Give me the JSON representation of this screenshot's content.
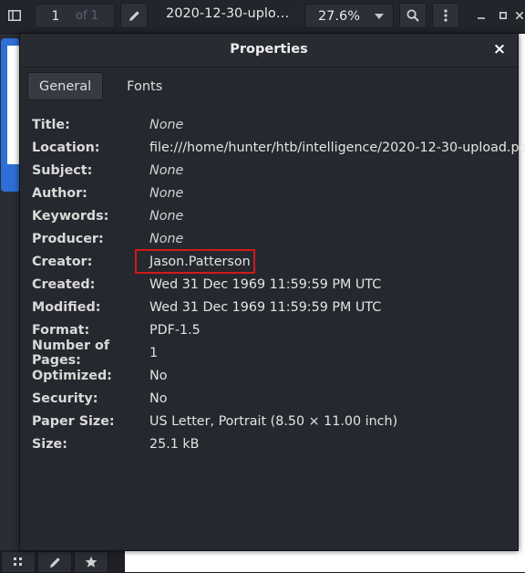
{
  "toolbar": {
    "page_number": "1",
    "page_total": "of 1",
    "document_title": "2020-12-30-uploa...",
    "zoom_level": "27.6%"
  },
  "dialog": {
    "title": "Properties",
    "close_label": "×",
    "tabs": [
      {
        "label": "General",
        "active": true
      },
      {
        "label": "Fonts",
        "active": false
      }
    ],
    "properties": [
      {
        "label": "Title:",
        "value": "None"
      },
      {
        "label": "Location:",
        "value": "file:///home/hunter/htb/intelligence/2020-12-30-upload.pdf"
      },
      {
        "label": "Subject:",
        "value": "None"
      },
      {
        "label": "Author:",
        "value": "None"
      },
      {
        "label": "Keywords:",
        "value": "None"
      },
      {
        "label": "Producer:",
        "value": "None"
      },
      {
        "label": "Creator:",
        "value": "Jason.Patterson"
      },
      {
        "label": "Created:",
        "value": "Wed 31 Dec 1969 11:59:59 PM UTC"
      },
      {
        "label": "Modified:",
        "value": "Wed 31 Dec 1969 11:59:59 PM UTC"
      },
      {
        "label": "Format:",
        "value": "PDF-1.5"
      },
      {
        "label": "Number of Pages:",
        "value": "1"
      },
      {
        "label": "Optimized:",
        "value": "No"
      },
      {
        "label": "Security:",
        "value": "No"
      },
      {
        "label": "Paper Size:",
        "value": "US Letter, Portrait (8.50 × 11.00 inch)"
      },
      {
        "label": "Size:",
        "value": "25.1 kB"
      }
    ]
  },
  "colors": {
    "highlight_border": "#d21a1a",
    "sidebar_selection": "#2d6fd6",
    "dialog_background": "#25282e"
  },
  "icons": [
    "sidebar-toggle-icon",
    "pencil-icon",
    "search-icon",
    "kebab-menu-icon",
    "minimize-icon",
    "maximize-icon",
    "close-icon",
    "thumbnails-icon",
    "annotate-icon",
    "bookmark-star-icon"
  ]
}
